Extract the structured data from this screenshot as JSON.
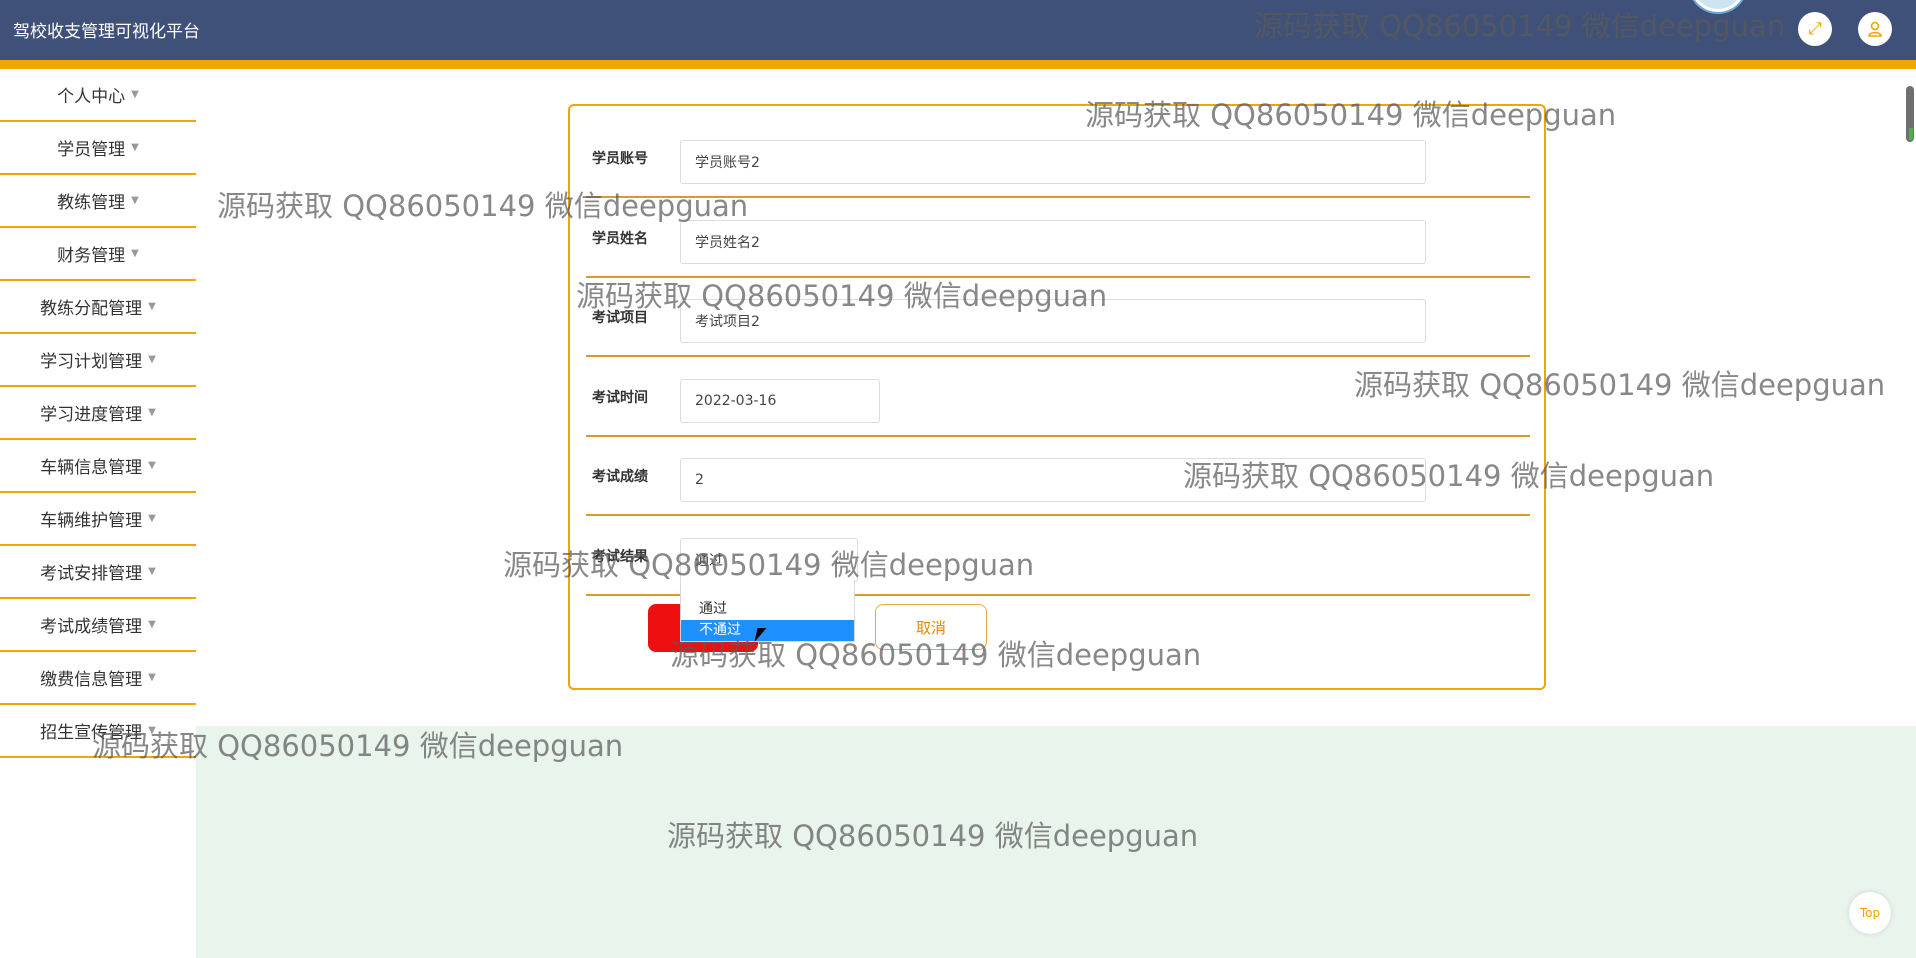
{
  "app": {
    "title": "驾校收支管理可视化平台"
  },
  "header": {
    "fullscreen_icon": "expand-icon",
    "user_icon": "user-icon"
  },
  "sidebar": {
    "items": [
      {
        "label": "个人中心"
      },
      {
        "label": "学员管理"
      },
      {
        "label": "教练管理"
      },
      {
        "label": "财务管理"
      },
      {
        "label": "教练分配管理"
      },
      {
        "label": "学习计划管理"
      },
      {
        "label": "学习进度管理"
      },
      {
        "label": "车辆信息管理"
      },
      {
        "label": "车辆维护管理"
      },
      {
        "label": "考试安排管理"
      },
      {
        "label": "考试成绩管理"
      },
      {
        "label": "缴费信息管理"
      },
      {
        "label": "招生宣传管理"
      }
    ]
  },
  "form": {
    "student_account": {
      "label": "学员账号",
      "value": "学员账号2"
    },
    "student_name": {
      "label": "学员姓名",
      "value": "学员姓名2"
    },
    "exam_item": {
      "label": "考试项目",
      "value": "考试项目2"
    },
    "exam_time": {
      "label": "考试时间",
      "value": "2022-03-16"
    },
    "exam_score": {
      "label": "考试成绩",
      "value": "2"
    },
    "exam_result": {
      "label": "考试结果",
      "value": "通过",
      "options": [
        "通过",
        "不通过"
      ],
      "highlighted": "不通过"
    },
    "cancel_label": "取消"
  },
  "scroll_top": {
    "label": "Top"
  },
  "watermark": {
    "text": "源码获取 QQ86050149 微信deepguan"
  }
}
